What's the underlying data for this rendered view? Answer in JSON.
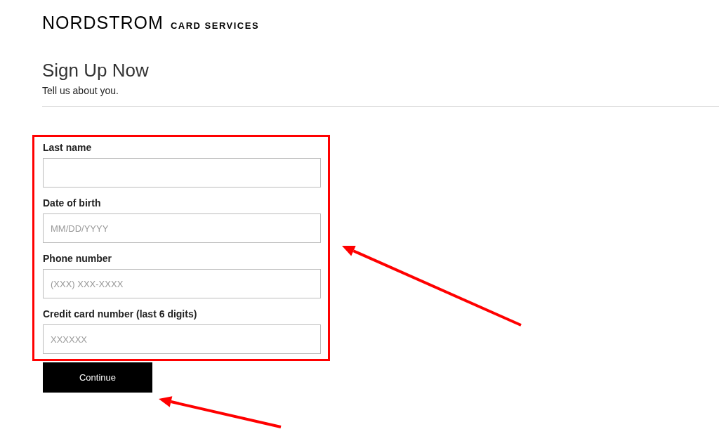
{
  "logo": {
    "wordmark": "NORDSTROM",
    "subtitle": "CARD SERVICES"
  },
  "heading": "Sign Up Now",
  "subheading": "Tell us about you.",
  "fields": [
    {
      "label": "Last name"
    },
    {
      "label": "Date of birth",
      "placeholder": "MM/DD/YYYY"
    },
    {
      "label": "Phone number",
      "placeholder": "(XXX) XXX-XXXX"
    },
    {
      "label": "Credit card number (last 6 digits)",
      "placeholder": "XXXXXX"
    }
  ],
  "button": "Continue"
}
